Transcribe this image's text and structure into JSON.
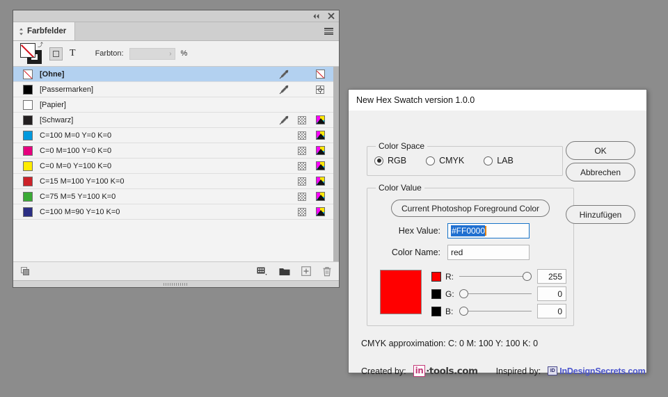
{
  "panel": {
    "tab_label": "Farbfelder",
    "titlebar": {
      "collapse_icon": "double-left-arrow-icon",
      "close_icon": "close-icon",
      "menu_icon": "panel-menu-icon"
    },
    "toolbar": {
      "fill_swatch": "none-fill-swatch",
      "stroke_swatch": "black-stroke-swatch",
      "swap_icon": "swap-fill-stroke-icon",
      "frame_button": "format-frame-button",
      "text_button_label": "T",
      "tint_label": "Farbton:",
      "tint_value": "",
      "tint_unit": "%"
    },
    "swatches": [
      {
        "name": "[Ohne]",
        "color": "none",
        "bold": true,
        "selected": true,
        "eyedropper": true,
        "tint": false,
        "cmyk": false,
        "none_mark": true,
        "registration": false
      },
      {
        "name": "[Passermarken]",
        "color": "#000000",
        "bold": false,
        "selected": false,
        "eyedropper": true,
        "tint": false,
        "cmyk": false,
        "none_mark": false,
        "registration": true
      },
      {
        "name": "[Papier]",
        "color": "#ffffff",
        "bold": false,
        "selected": false,
        "eyedropper": false,
        "tint": false,
        "cmyk": false,
        "none_mark": false,
        "registration": false
      },
      {
        "name": "[Schwarz]",
        "color": "#231f20",
        "bold": false,
        "selected": false,
        "eyedropper": true,
        "tint": true,
        "cmyk": true,
        "none_mark": false,
        "registration": false
      },
      {
        "name": "C=100 M=0 Y=0 K=0",
        "color": "#0099dd",
        "bold": false,
        "selected": false,
        "eyedropper": false,
        "tint": true,
        "cmyk": true,
        "none_mark": false,
        "registration": false
      },
      {
        "name": "C=0 M=100 Y=0 K=0",
        "color": "#e6007e",
        "bold": false,
        "selected": false,
        "eyedropper": false,
        "tint": true,
        "cmyk": true,
        "none_mark": false,
        "registration": false
      },
      {
        "name": "C=0 M=0 Y=100 K=0",
        "color": "#ffec00",
        "bold": false,
        "selected": false,
        "eyedropper": false,
        "tint": true,
        "cmyk": true,
        "none_mark": false,
        "registration": false
      },
      {
        "name": "C=15 M=100 Y=100 K=0",
        "color": "#cc2229",
        "bold": false,
        "selected": false,
        "eyedropper": false,
        "tint": true,
        "cmyk": true,
        "none_mark": false,
        "registration": false
      },
      {
        "name": "C=75 M=5 Y=100 K=0",
        "color": "#3aaa35",
        "bold": false,
        "selected": false,
        "eyedropper": false,
        "tint": true,
        "cmyk": true,
        "none_mark": false,
        "registration": false
      },
      {
        "name": "C=100 M=90 Y=10 K=0",
        "color": "#2b2e83",
        "bold": false,
        "selected": false,
        "eyedropper": false,
        "tint": true,
        "cmyk": true,
        "none_mark": false,
        "registration": false
      }
    ],
    "bottombar": {
      "show_swatch_groups_icon": "show-all-swatches-icon",
      "color_group_icon": "new-color-group-icon",
      "folder_icon": "new-swatch-group-folder-icon",
      "new_swatch_icon": "new-swatch-icon",
      "delete_icon": "delete-swatch-icon"
    }
  },
  "dialog": {
    "title": "New Hex Swatch version 1.0.0",
    "color_space": {
      "legend": "Color Space",
      "options": [
        {
          "label": "RGB",
          "selected": true
        },
        {
          "label": "CMYK",
          "selected": false
        },
        {
          "label": "LAB",
          "selected": false
        }
      ]
    },
    "color_value": {
      "legend": "Color Value",
      "photoshop_button": "Current Photoshop Foreground Color",
      "hex_label": "Hex Value:",
      "hex_value": "#FF0000",
      "name_label": "Color Name:",
      "name_value": "red",
      "preview_color": "#ff0000",
      "channels": [
        {
          "label": "R:",
          "value": "255",
          "chip": "#ff0000",
          "percent": 100
        },
        {
          "label": "G:",
          "value": "0",
          "chip": "#000000",
          "percent": 0
        },
        {
          "label": "B:",
          "value": "0",
          "chip": "#000000",
          "percent": 0
        }
      ]
    },
    "cmyk_approximation": "CMYK approximation: C: 0 M: 100 Y: 100 K: 0",
    "credits": {
      "created_label": "Created by:",
      "created_logo_box": "in",
      "created_logo_text": "·tools.com",
      "inspired_label": "Inspired by:",
      "inspired_logo_icon": "ID",
      "inspired_logo_text": "InDesignSecrets.com"
    },
    "buttons": {
      "ok": "OK",
      "cancel": "Abbrechen",
      "add": "Hinzufügen"
    }
  },
  "colors": {
    "accent_blue": "#1f6fd0",
    "selection_row": "#b3d1f0",
    "link_blue": "#4b55cc",
    "logo_pink": "#c23a78"
  }
}
